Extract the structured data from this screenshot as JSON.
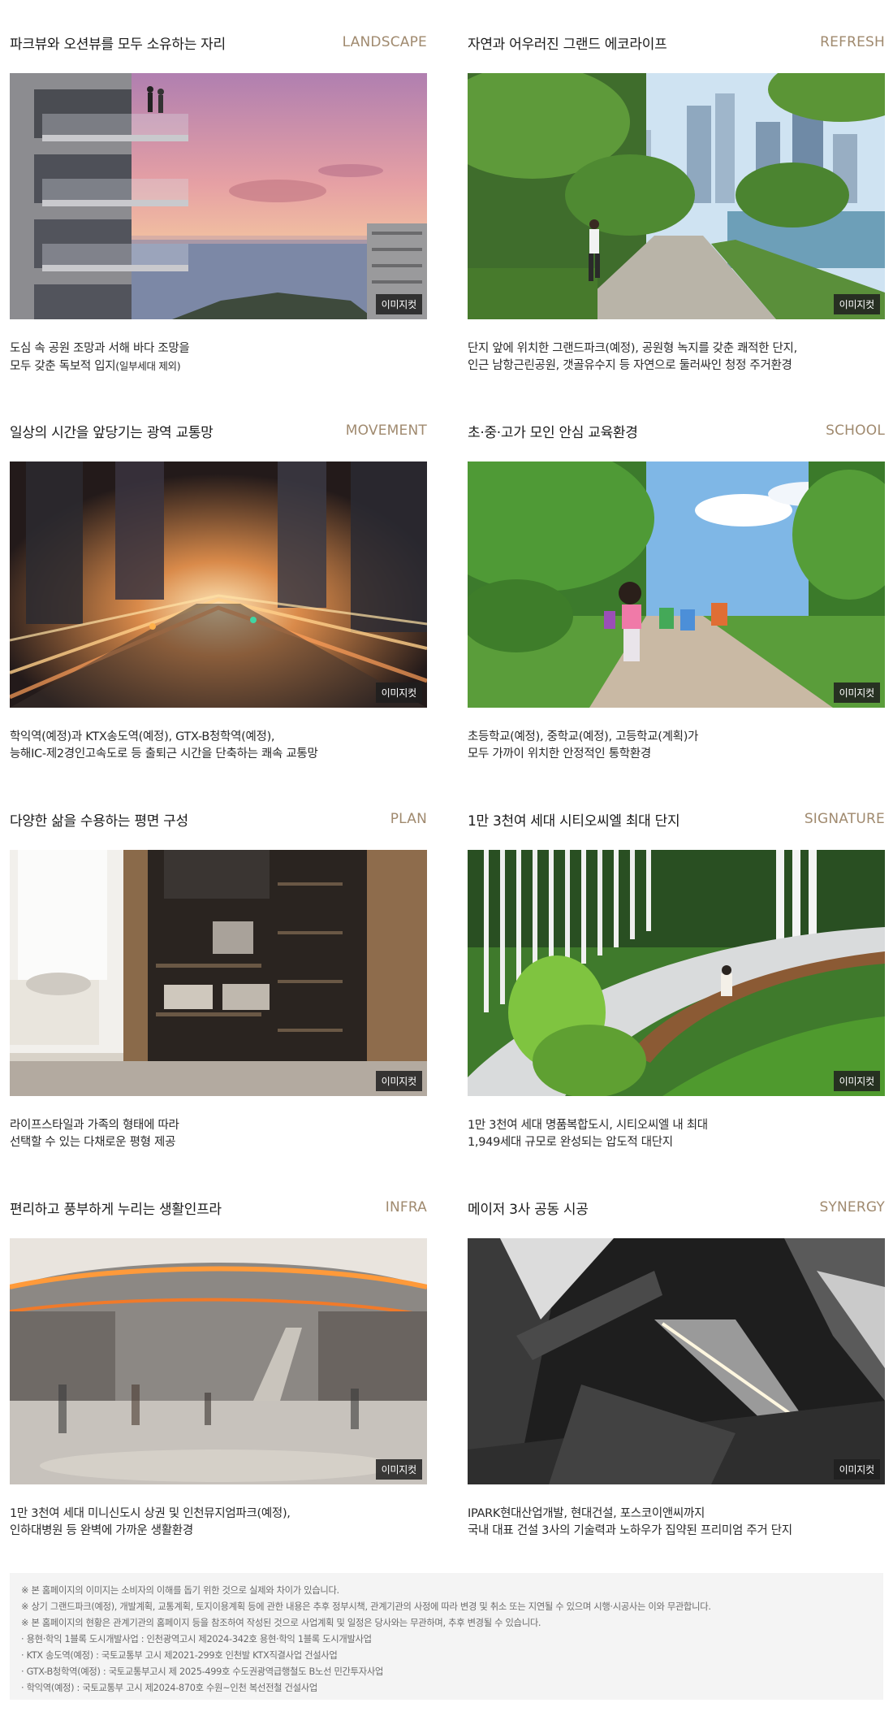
{
  "badge_label": "이미지컷",
  "cards": [
    {
      "title": "파크뷰와 오션뷰를 모두 소유하는 자리",
      "tag": "LANDSCAPE",
      "line1": "도심 속 공원 조망과 서해 바다 조망을",
      "line2": "모두 갖춘 독보적 입지",
      "line2_small": "(일부세대 제외)"
    },
    {
      "title": "자연과 어우러진 그랜드 에코라이프",
      "tag": "REFRESH",
      "line1": "단지 앞에 위치한 그랜드파크(예정), 공원형 녹지를 갖춘 쾌적한 단지,",
      "line2": "인근 남항근린공원, 갯골유수지 등 자연으로 둘러싸인 청정 주거환경",
      "line2_small": ""
    },
    {
      "title": "일상의 시간을 앞당기는 광역 교통망",
      "tag": "MOVEMENT",
      "line1": "학익역(예정)과 KTX송도역(예정), GTX-B청학역(예정),",
      "line2": "능해IC-제2경인고속도로 등 출퇴근 시간을 단축하는 쾌속 교통망",
      "line2_small": ""
    },
    {
      "title": "초·중·고가 모인 안심 교육환경",
      "tag": "SCHOOL",
      "line1": "초등학교(예정), 중학교(예정), 고등학교(계획)가",
      "line2": "모두 가까이 위치한 안정적인 통학환경",
      "line2_small": ""
    },
    {
      "title": "다양한 삶을 수용하는 평면 구성",
      "tag": "PLAN",
      "line1": "라이프스타일과 가족의 형태에 따라",
      "line2": "선택할 수 있는 다채로운 평형 제공",
      "line2_small": ""
    },
    {
      "title": "1만 3천여 세대 시티오씨엘 최대 단지",
      "tag": "SIGNATURE",
      "line1": "1만 3천여 세대 명품복합도시, 시티오씨엘 내 최대",
      "line2": "1,949세대 규모로 완성되는 압도적 대단지",
      "line2_small": ""
    },
    {
      "title": "편리하고 풍부하게 누리는 생활인프라",
      "tag": "INFRA",
      "line1": "1만 3천여 세대 미니신도시 상권 및 인천뮤지엄파크(예정),",
      "line2": "인하대병원 등 완벽에 가까운 생활환경",
      "line2_small": ""
    },
    {
      "title": "메이저 3사 공동 시공",
      "tag": "SYNERGY",
      "line1": "IPARK현대산업개발, 현대건설, 포스코이앤씨까지",
      "line2": "국내 대표 건설 3사의 기술력과 노하우가 집약된 프리미엄 주거 단지",
      "line2_small": ""
    }
  ],
  "notes": [
    "※ 본 홈페이지의 이미지는 소비자의 이해를 돕기 위한 것으로 실제와 차이가 있습니다.",
    "※ 상기 그랜드파크(예정), 개발계획, 교통계획, 토지이용계획 등에 관한 내용은 추후 정부시책, 관계기관의 사정에 따라 변경 및 취소 또는 지연될 수 있으며 시행·시공사는 이와 무관합니다.",
    "※ 본 홈페이지의 현황은 관계기관의 홈페이지 등을 참조하여 작성된 것으로 사업계획 및 일정은 당사와는 무관하며, 추후 변경될 수 있습니다.",
    "· 용현·학익 1블록 도시개발사업 : 인천광역고시 제2024-342호 용현·학익 1블록 도시개발사업",
    "· KTX 송도역(예정) : 국토교통부 고시 제2021-299호 인천발 KTX직결사업 건설사업",
    "· GTX-B청학역(예정) : 국토교통부고시 제 2025-499호 수도권광역급행철도 B노선 민간투자사업",
    "· 학익역(예정) : 국토교통부 고시 제2024-870호 수원~인천 복선전철 건설사업"
  ]
}
